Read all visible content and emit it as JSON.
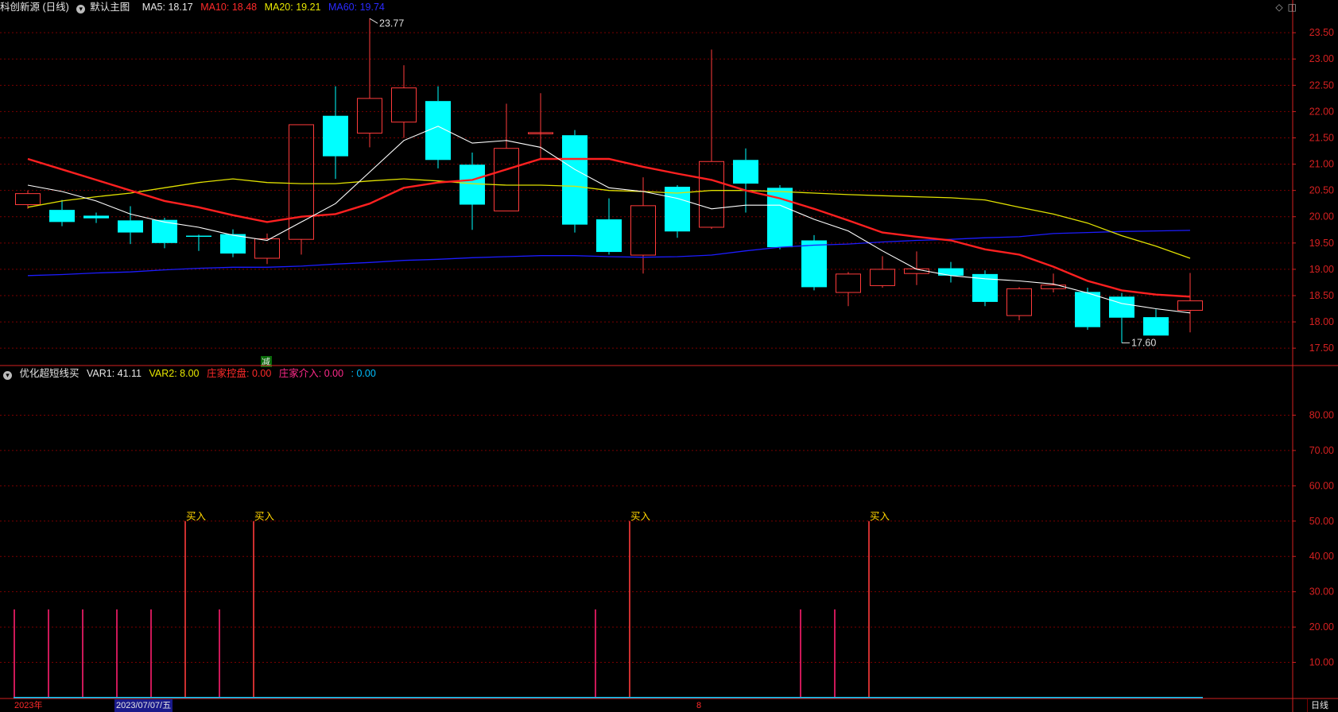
{
  "main_header": {
    "title": "科创新源 (日线)",
    "template": "默认主图",
    "ma5": "MA5: 18.17",
    "ma10": "MA10: 18.48",
    "ma20": "MA20: 19.21",
    "ma60": "MA60: 19.74"
  },
  "sub_header": {
    "name": "优化超短线买",
    "var1": "VAR1: 41.11",
    "var2": "VAR2: 8.00",
    "zhuang_ctrl": "庄家控盘: 0.00",
    "zhuang_in": "庄家介入: 0.00",
    "extra": ": 0.00"
  },
  "footer": {
    "year": "2023年",
    "date": "2023/07/07/五",
    "month": "8",
    "period": "日线"
  },
  "colors": {
    "up": "#ff3b3b",
    "down": "#00ffff",
    "ma5": "#ffffff",
    "ma10": "#ff2020",
    "ma20": "#e0e000",
    "ma60": "#1c1cff",
    "grid": "#7a0000",
    "axis": "#d42020",
    "signal": "#ff1f6e",
    "buy_text": "#ffd400",
    "base": "#00ccff"
  },
  "icons": [
    "collapse-icon",
    "diamond-icon",
    "panel-icon"
  ],
  "chart_data": [
    {
      "type": "candlestick",
      "ylim": [
        17.2,
        23.85
      ],
      "yticks": [
        17.5,
        18.0,
        18.5,
        19.0,
        19.5,
        20.0,
        20.5,
        21.0,
        21.5,
        22.0,
        22.5,
        23.0,
        23.5
      ],
      "candles": [
        {
          "o": 20.23,
          "c": 20.44,
          "h": 20.5,
          "l": 20.15
        },
        {
          "o": 20.13,
          "c": 19.9,
          "h": 20.32,
          "l": 19.82
        },
        {
          "o": 20.02,
          "c": 19.97,
          "h": 20.08,
          "l": 19.88
        },
        {
          "o": 19.93,
          "c": 19.7,
          "h": 20.2,
          "l": 19.48
        },
        {
          "o": 19.94,
          "c": 19.5,
          "h": 19.98,
          "l": 19.4
        },
        {
          "o": 19.64,
          "c": 19.62,
          "h": 19.66,
          "l": 19.35
        },
        {
          "o": 19.67,
          "c": 19.3,
          "h": 19.76,
          "l": 19.23
        },
        {
          "o": 19.21,
          "c": 19.58,
          "h": 19.68,
          "l": 19.1
        },
        {
          "o": 19.57,
          "c": 21.75,
          "h": 21.75,
          "l": 19.28
        },
        {
          "o": 21.92,
          "c": 21.15,
          "h": 22.48,
          "l": 20.72
        },
        {
          "o": 21.59,
          "c": 22.25,
          "h": 23.77,
          "l": 21.32
        },
        {
          "o": 21.8,
          "c": 22.45,
          "h": 22.88,
          "l": 21.5
        },
        {
          "o": 22.2,
          "c": 21.08,
          "h": 22.48,
          "l": 20.92
        },
        {
          "o": 20.99,
          "c": 20.23,
          "h": 21.22,
          "l": 19.75
        },
        {
          "o": 20.11,
          "c": 21.3,
          "h": 22.15,
          "l": 20.11
        },
        {
          "o": 21.6,
          "c": 21.6,
          "h": 22.35,
          "l": 21.1
        },
        {
          "o": 21.55,
          "c": 19.85,
          "h": 21.65,
          "l": 19.7
        },
        {
          "o": 19.95,
          "c": 19.33,
          "h": 20.35,
          "l": 19.28
        },
        {
          "o": 19.27,
          "c": 20.21,
          "h": 20.75,
          "l": 18.92
        },
        {
          "o": 20.57,
          "c": 19.72,
          "h": 20.6,
          "l": 19.6
        },
        {
          "o": 19.8,
          "c": 21.05,
          "h": 23.18,
          "l": 19.77
        },
        {
          "o": 21.08,
          "c": 20.63,
          "h": 21.3,
          "l": 20.08
        },
        {
          "o": 20.55,
          "c": 19.42,
          "h": 20.6,
          "l": 19.38
        },
        {
          "o": 19.55,
          "c": 18.66,
          "h": 19.65,
          "l": 18.6
        },
        {
          "o": 18.56,
          "c": 18.91,
          "h": 18.95,
          "l": 18.3
        },
        {
          "o": 18.69,
          "c": 19.0,
          "h": 19.25,
          "l": 18.65
        },
        {
          "o": 18.92,
          "c": 19.01,
          "h": 19.34,
          "l": 18.7
        },
        {
          "o": 19.02,
          "c": 18.88,
          "h": 19.14,
          "l": 18.75
        },
        {
          "o": 18.91,
          "c": 18.38,
          "h": 18.98,
          "l": 18.3
        },
        {
          "o": 18.12,
          "c": 18.63,
          "h": 18.66,
          "l": 18.03
        },
        {
          "o": 18.63,
          "c": 18.7,
          "h": 18.92,
          "l": 18.56
        },
        {
          "o": 18.57,
          "c": 17.9,
          "h": 18.65,
          "l": 17.85
        },
        {
          "o": 18.48,
          "c": 18.08,
          "h": 18.55,
          "l": 17.6
        },
        {
          "o": 18.09,
          "c": 17.74,
          "h": 18.24,
          "l": 17.74
        },
        {
          "o": 18.22,
          "c": 18.4,
          "h": 18.93,
          "l": 17.8
        }
      ],
      "ma5": [
        20.6,
        20.48,
        20.3,
        20.05,
        19.9,
        19.8,
        19.65,
        19.55,
        19.9,
        20.25,
        20.85,
        21.45,
        21.72,
        21.4,
        21.45,
        21.32,
        20.9,
        20.55,
        20.48,
        20.35,
        20.15,
        20.22,
        20.22,
        19.95,
        19.73,
        19.35,
        19.0,
        18.88,
        18.82,
        18.78,
        18.72,
        18.55,
        18.35,
        18.25,
        18.17
      ],
      "ma10": [
        21.1,
        20.9,
        20.7,
        20.5,
        20.3,
        20.18,
        20.03,
        19.9,
        20.0,
        20.05,
        20.25,
        20.55,
        20.65,
        20.7,
        20.9,
        21.1,
        21.1,
        21.1,
        20.95,
        20.82,
        20.7,
        20.5,
        20.35,
        20.15,
        19.93,
        19.7,
        19.62,
        19.55,
        19.38,
        19.28,
        19.05,
        18.78,
        18.6,
        18.52,
        18.48
      ],
      "ma20": [
        20.18,
        20.3,
        20.38,
        20.45,
        20.55,
        20.65,
        20.72,
        20.65,
        20.63,
        20.63,
        20.68,
        20.72,
        20.68,
        20.63,
        20.6,
        20.6,
        20.58,
        20.5,
        20.48,
        20.45,
        20.5,
        20.5,
        20.48,
        20.45,
        20.42,
        20.4,
        20.38,
        20.36,
        20.32,
        20.18,
        20.05,
        19.88,
        19.64,
        19.44,
        19.21
      ],
      "ma60": [
        18.88,
        18.9,
        18.93,
        18.95,
        18.99,
        19.02,
        19.04,
        19.04,
        19.06,
        19.1,
        19.13,
        19.17,
        19.19,
        19.22,
        19.24,
        19.26,
        19.26,
        19.24,
        19.23,
        19.24,
        19.27,
        19.35,
        19.42,
        19.46,
        19.48,
        19.52,
        19.55,
        19.57,
        19.6,
        19.62,
        19.68,
        19.7,
        19.72,
        19.73,
        19.74
      ],
      "annotations": [
        {
          "index": 10,
          "value": 23.77,
          "text": "23.77"
        },
        {
          "index": 32,
          "value": 17.6,
          "text": "17.60"
        },
        {
          "index": 7,
          "text": "减"
        }
      ]
    },
    {
      "type": "bar",
      "ylim": [
        0,
        90
      ],
      "yticks": [
        10,
        20,
        30,
        40,
        50,
        60,
        70,
        80
      ],
      "ytick_labels": [
        "10.00",
        "20.00",
        "30.00",
        "40.00",
        "50.00",
        "60.00",
        "70.00",
        "80.00"
      ],
      "signals": [
        {
          "index": 0,
          "value": 25,
          "buy": false
        },
        {
          "index": 1,
          "value": 25,
          "buy": false
        },
        {
          "index": 2,
          "value": 25,
          "buy": false
        },
        {
          "index": 3,
          "value": 25,
          "buy": false
        },
        {
          "index": 4,
          "value": 25,
          "buy": false
        },
        {
          "index": 5,
          "value": 50,
          "buy": true
        },
        {
          "index": 6,
          "value": 25,
          "buy": false
        },
        {
          "index": 7,
          "value": 50,
          "buy": true
        },
        {
          "index": 17,
          "value": 25,
          "buy": false
        },
        {
          "index": 18,
          "value": 50,
          "buy": true
        },
        {
          "index": 23,
          "value": 25,
          "buy": false
        },
        {
          "index": 24,
          "value": 25,
          "buy": false
        },
        {
          "index": 25,
          "value": 50,
          "buy": true
        }
      ],
      "buy_label": "买入",
      "baseline": 0
    }
  ]
}
